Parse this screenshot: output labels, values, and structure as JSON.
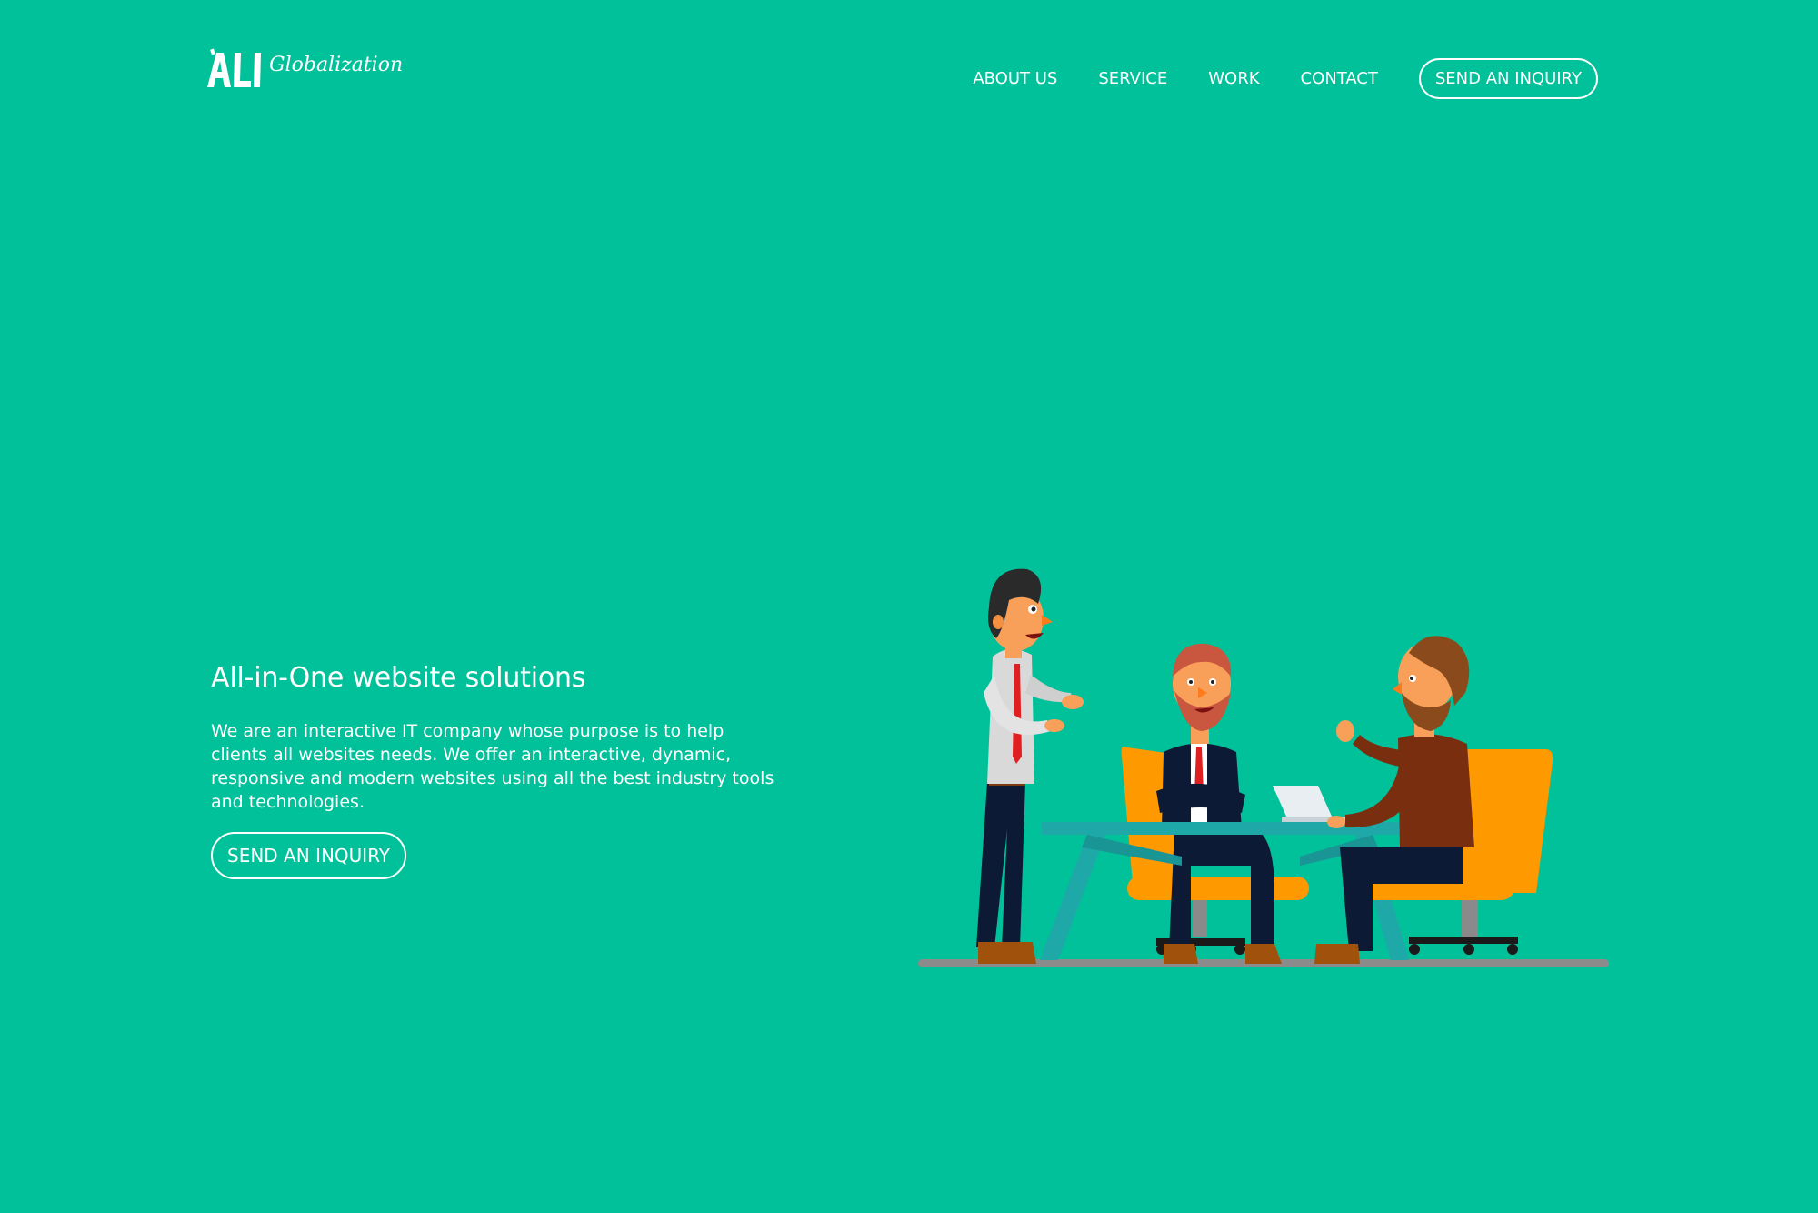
{
  "logo": {
    "mark": "ALI",
    "text": "Globalization"
  },
  "nav": {
    "items": [
      {
        "label": "ABOUT US"
      },
      {
        "label": "SERVICE"
      },
      {
        "label": "WORK"
      },
      {
        "label": "CONTACT"
      }
    ],
    "cta_label": "SEND AN INQUIRY"
  },
  "hero": {
    "title": "All-in-One website solutions",
    "description": "We are an interactive IT company whose purpose is to help clients all websites needs. We offer an interactive, dynamic, responsive and modern websites using all the best industry tools and technologies.",
    "cta_label": "SEND AN INQUIRY"
  },
  "colors": {
    "background": "#00c19a",
    "text": "#ffffff",
    "chair": "#ff9900",
    "table": "#1fa8a8"
  },
  "illustration": {
    "icon": "business-meeting-illustration"
  }
}
